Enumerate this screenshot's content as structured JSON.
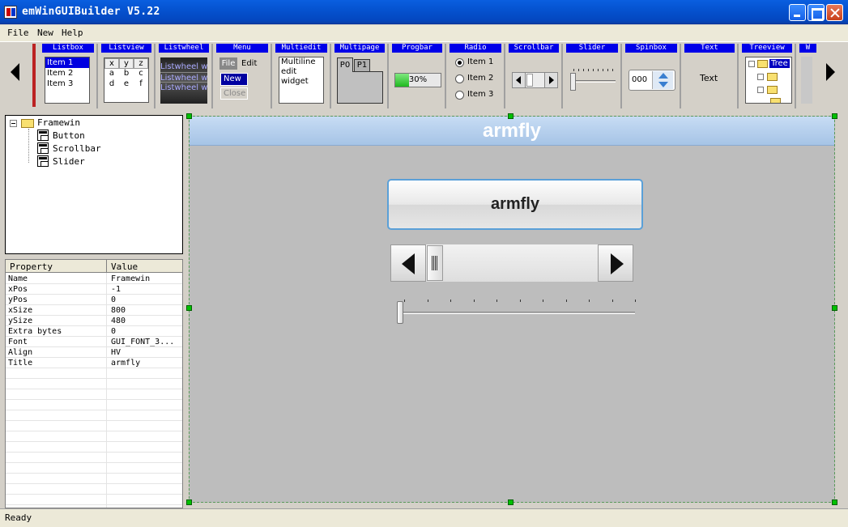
{
  "window": {
    "title": "emWinGUIBuilder V5.22"
  },
  "menu": {
    "file": "File",
    "new": "New",
    "help": "Help"
  },
  "palette": {
    "cells": [
      {
        "label": "Listbox"
      },
      {
        "label": "Listview"
      },
      {
        "label": "Listwheel"
      },
      {
        "label": "Menu"
      },
      {
        "label": "Multiedit"
      },
      {
        "label": "Multipage"
      },
      {
        "label": "Progbar"
      },
      {
        "label": "Radio"
      },
      {
        "label": "Scrollbar"
      },
      {
        "label": "Slider"
      },
      {
        "label": "Spinbox"
      },
      {
        "label": "Text"
      },
      {
        "label": "Treeview"
      },
      {
        "label": "W"
      }
    ],
    "listbox_items": [
      "Item 1",
      "Item 2",
      "Item 3"
    ],
    "listview_cells": [
      "x",
      "y",
      "z",
      "a",
      "b",
      "c",
      "d",
      "e",
      "f"
    ],
    "listwheel_items": [
      "Listwheel wi",
      "Listwheel wi",
      "Listwheel wi"
    ],
    "menu_items": {
      "file": "File",
      "edit": "Edit",
      "new": "New",
      "close": "Close"
    },
    "multiedit_lines": [
      "Multiline",
      "edit",
      "widget"
    ],
    "multipage_tabs": [
      "P0",
      "P1"
    ],
    "progbar_text": "30%",
    "progress_value": 0.3,
    "radio_items": [
      "Item 1",
      "Item 2",
      "Item 3"
    ],
    "spinbox_value": "000",
    "text_preview": "Text",
    "treeview_preview": "Tree"
  },
  "tree": {
    "root": "Framewin",
    "children": [
      "Button",
      "Scrollbar",
      "Slider"
    ]
  },
  "properties": {
    "header": {
      "key": "Property",
      "value": "Value"
    },
    "rows": [
      {
        "k": "Name",
        "v": "Framewin"
      },
      {
        "k": "xPos",
        "v": "-1"
      },
      {
        "k": "yPos",
        "v": "0"
      },
      {
        "k": "xSize",
        "v": "800"
      },
      {
        "k": "ySize",
        "v": "480"
      },
      {
        "k": "Extra bytes",
        "v": "0"
      },
      {
        "k": "Font",
        "v": "GUI_FONT_3..."
      },
      {
        "k": "Align",
        "v": "HV"
      },
      {
        "k": "Title",
        "v": "armfly"
      }
    ]
  },
  "canvas": {
    "frame_title": "armfly",
    "button_label": "armfly",
    "scrollbar_value": 0,
    "slider_value": 0
  },
  "status": {
    "text": "Ready"
  }
}
